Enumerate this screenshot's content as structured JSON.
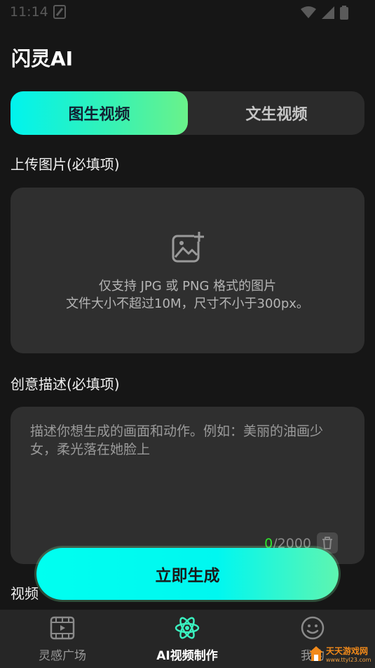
{
  "status_bar": {
    "time": "11:14"
  },
  "app": {
    "title": "闪灵AI"
  },
  "tabs": [
    {
      "label": "图生视频",
      "active": true
    },
    {
      "label": "文生视频",
      "active": false
    }
  ],
  "upload": {
    "label": "上传图片(必填项)",
    "hint_line1": "仅支持 JPG 或 PNG 格式的图片",
    "hint_line2": "文件大小不超过10M，尺寸不小于300px。"
  },
  "description": {
    "label": "创意描述(必填项)",
    "placeholder": "描述你想生成的画面和动作。例如：美丽的油画少女，柔光落在她脸上",
    "current_count": "0",
    "max_count": "/2000"
  },
  "next_section_label": "视频",
  "generate_button": {
    "label": "立即生成"
  },
  "bottom_nav": [
    {
      "label": "灵感广场",
      "icon": "film-icon",
      "active": false
    },
    {
      "label": "AI视频制作",
      "icon": "atom-icon",
      "active": true
    },
    {
      "label": "我的",
      "icon": "smiley-icon",
      "active": false
    }
  ],
  "watermark": {
    "text": "天天游戏网",
    "url_text": "www.ttyl23.com"
  },
  "colors": {
    "accent_cyan": "#00f7f0",
    "accent_green": "#6af28a",
    "background": "#161616",
    "card": "#2f2f2f"
  }
}
